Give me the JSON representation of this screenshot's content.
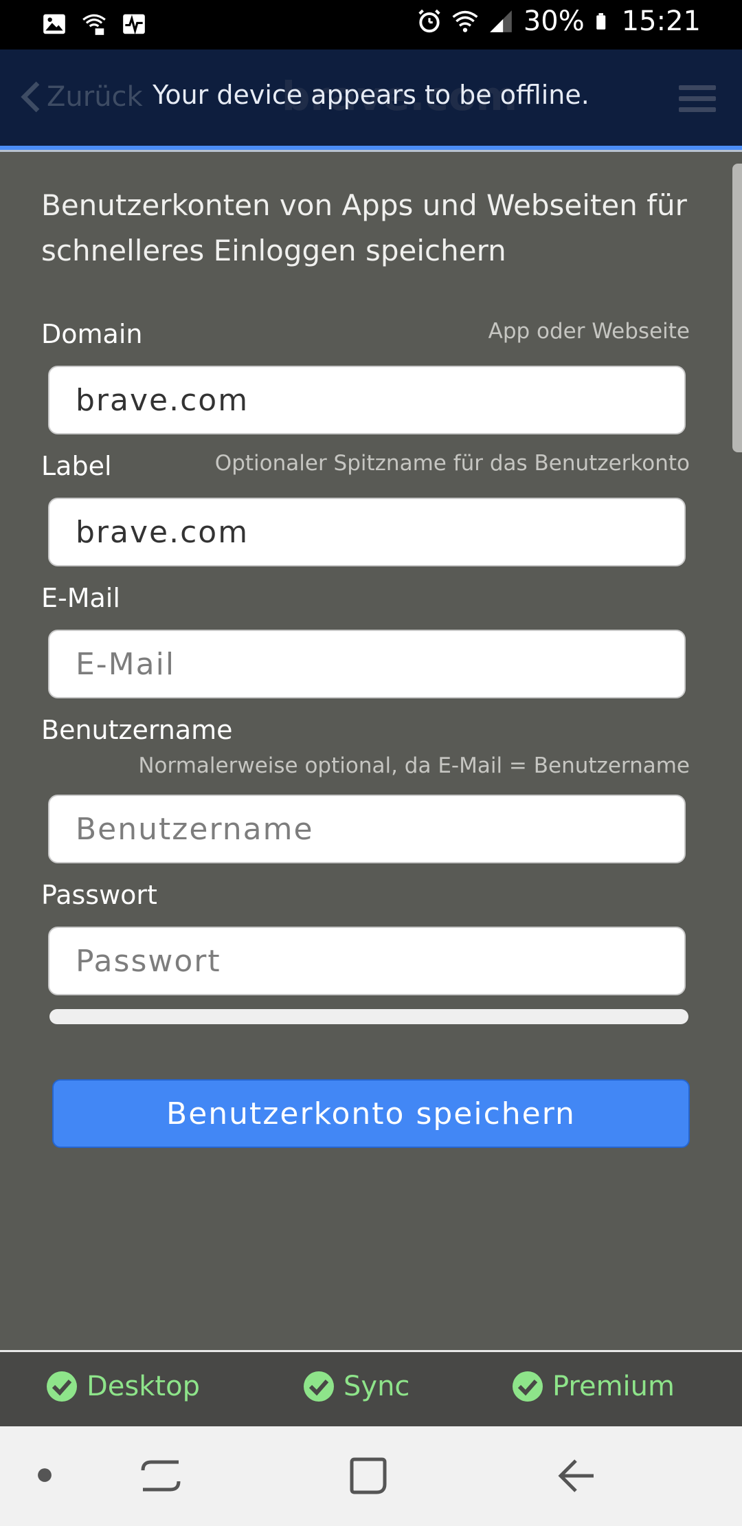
{
  "status_bar": {
    "battery_percent": "30%",
    "time": "15:21"
  },
  "topbar": {
    "back_label": "Zurück",
    "ghost_title": "brave.com",
    "offline_message": "Your device appears to be offline."
  },
  "form": {
    "intro": "Benutzerkonten von Apps und Webseiten für schnelleres Einloggen speichern",
    "domain": {
      "label": "Domain",
      "hint": "App oder Webseite",
      "value": "brave.com"
    },
    "label_field": {
      "label": "Label",
      "hint": "Optionaler Spitzname für das Benutzerkonto",
      "value": "brave.com"
    },
    "email": {
      "label": "E-Mail",
      "placeholder": "E-Mail"
    },
    "username": {
      "label": "Benutzername",
      "hint": "Normalerweise optional, da E-Mail = Benutzername",
      "placeholder": "Benutzername"
    },
    "password": {
      "label": "Passwort",
      "placeholder": "Passwort"
    },
    "save_label": "Benutzerkonto speichern"
  },
  "footer": {
    "items": [
      "Desktop",
      "Sync",
      "Premium"
    ],
    "check_color": "#8ee48a"
  },
  "colors": {
    "accent": "#4287f5",
    "topbar": "#0e1e3e",
    "background": "#595a55"
  }
}
